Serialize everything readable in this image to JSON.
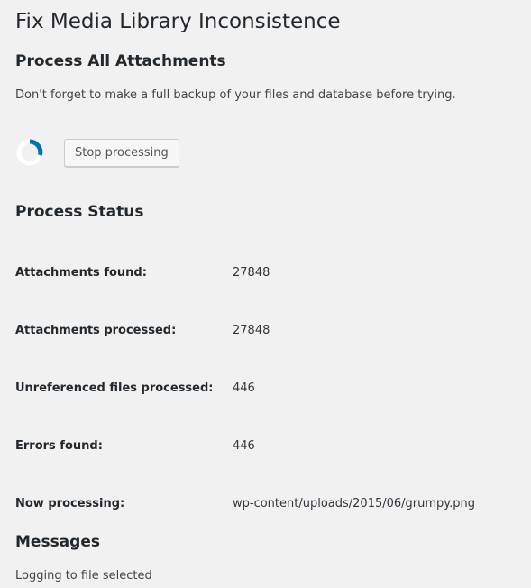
{
  "page": {
    "title": "Fix Media Library Inconsistence"
  },
  "process_all": {
    "heading": "Process All Attachments",
    "notice": "Don't forget to make a full backup of your files and database before trying.",
    "stop_button_label": "Stop processing",
    "spinner_icon": "loading-spinner-icon",
    "spinner_color": "#0073aa"
  },
  "status": {
    "heading": "Process Status",
    "rows": [
      {
        "label": "Attachments found:",
        "value": "27848"
      },
      {
        "label": "Attachments processed:",
        "value": "27848"
      },
      {
        "label": "Unreferenced files processed:",
        "value": "446"
      },
      {
        "label": "Errors found:",
        "value": "446"
      },
      {
        "label": "Now processing:",
        "value": "wp-content/uploads/2015/06/grumpy.png"
      }
    ]
  },
  "messages": {
    "heading": "Messages",
    "items": [
      "Logging to file selected"
    ]
  }
}
